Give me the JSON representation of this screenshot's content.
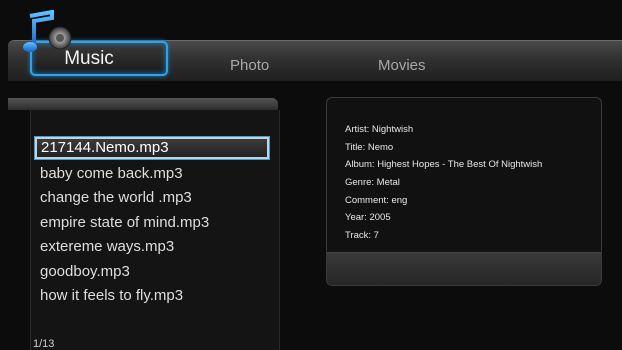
{
  "tabs": {
    "music": "Music",
    "photo": "Photo",
    "movies": "Movies",
    "active_color": "#2fa3e8"
  },
  "icons": {
    "music": "music-note-icon"
  },
  "file_list": {
    "items": [
      {
        "label": "217144.Nemo.mp3",
        "selected": true
      },
      {
        "label": "baby come back.mp3",
        "selected": false
      },
      {
        "label": "change the world .mp3",
        "selected": false
      },
      {
        "label": "empire state of mind.mp3",
        "selected": false
      },
      {
        "label": "extereme ways.mp3",
        "selected": false
      },
      {
        "label": "goodboy.mp3",
        "selected": false
      },
      {
        "label": "how it feels to fly.mp3",
        "selected": false
      }
    ],
    "page_indicator": "1/13"
  },
  "track_info": {
    "artist": "Artist: Nightwish",
    "title": "Title: Nemo",
    "album": "Album: Highest Hopes - The Best Of Nightwish",
    "genre": "Genre: Metal",
    "comment": "Comment: eng",
    "year": "Year: 2005",
    "track": "Track: 7"
  }
}
